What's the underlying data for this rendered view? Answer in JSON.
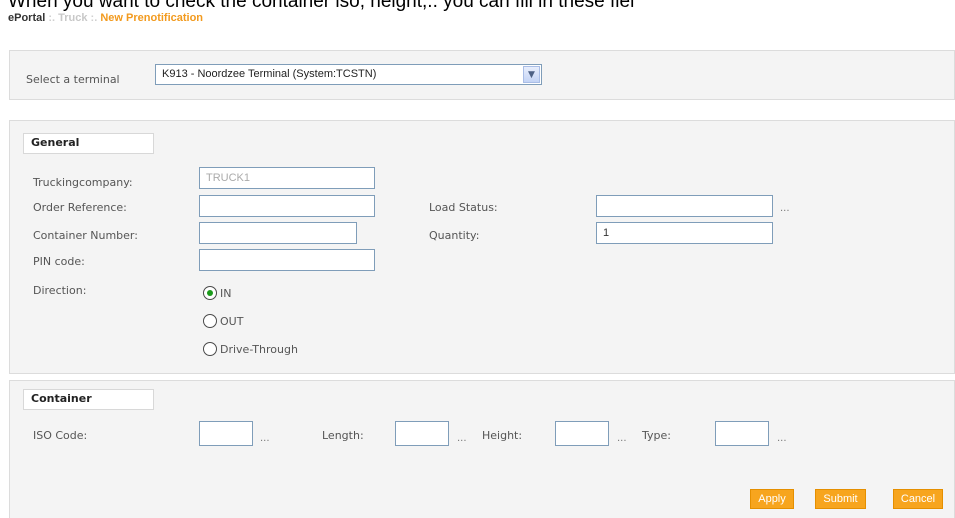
{
  "page": {
    "top_text": "When you want to check the container iso, height,.. you can fill in these fiel",
    "breadcrumb": {
      "portal": "ePortal",
      "sep1": " :. ",
      "truck": "Truck",
      "sep2": " :. ",
      "current": "New Prenotification"
    }
  },
  "terminal": {
    "label": "Select a terminal",
    "selected": "K913 - Noordzee Terminal (System:TCSTN)"
  },
  "general": {
    "header": "General",
    "truckingcompany": {
      "label": "Truckingcompany:",
      "value": "TRUCK1"
    },
    "order_reference": {
      "label": "Order Reference:",
      "value": ""
    },
    "load_status": {
      "label": "Load Status:",
      "value": "",
      "lookup": "..."
    },
    "container_number": {
      "label": "Container Number:",
      "value": ""
    },
    "quantity": {
      "label": "Quantity:",
      "value": "1"
    },
    "pin_code": {
      "label": "PIN code:",
      "value": ""
    },
    "direction": {
      "label": "Direction:",
      "options": [
        "IN",
        "OUT",
        "Drive-Through"
      ],
      "selected": "IN"
    }
  },
  "container": {
    "header": "Container",
    "iso_code": {
      "label": "ISO Code:",
      "value": "",
      "lookup": "..."
    },
    "length": {
      "label": "Length:",
      "value": "",
      "lookup": "..."
    },
    "height": {
      "label": "Height:",
      "value": "",
      "lookup": "..."
    },
    "type": {
      "label": "Type:",
      "value": "",
      "lookup": "..."
    }
  },
  "actions": {
    "apply": "Apply",
    "submit": "Submit",
    "cancel": "Cancel"
  },
  "colors": {
    "accent": "#f7a51e",
    "radio_selected": "#1c9b1c",
    "panel_bg": "#f4f4f4"
  }
}
